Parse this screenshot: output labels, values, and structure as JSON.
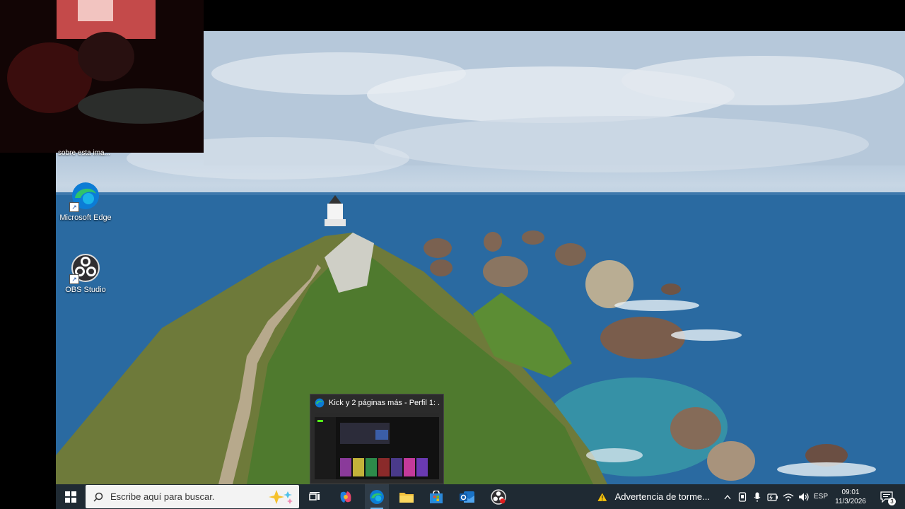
{
  "desktop": {
    "partial_label": "sobre esta ima...",
    "icons": [
      {
        "name": "Microsoft Edge",
        "icon": "edge-icon"
      },
      {
        "name": "OBS Studio",
        "icon": "obs-icon"
      }
    ]
  },
  "preview": {
    "title": "Kick y 2 páginas más - Perfil 1: ..."
  },
  "taskbar": {
    "search_placeholder": "Escribe aquí para buscar.",
    "weather": "Advertencia de torme...",
    "language": "ESP",
    "time": "09:01",
    "date": "11/3/2026",
    "notification_count": "3"
  },
  "colors": {
    "taskbar": "#1f2a33",
    "accent": "#0a84d6",
    "warning": "#f4c20d"
  }
}
